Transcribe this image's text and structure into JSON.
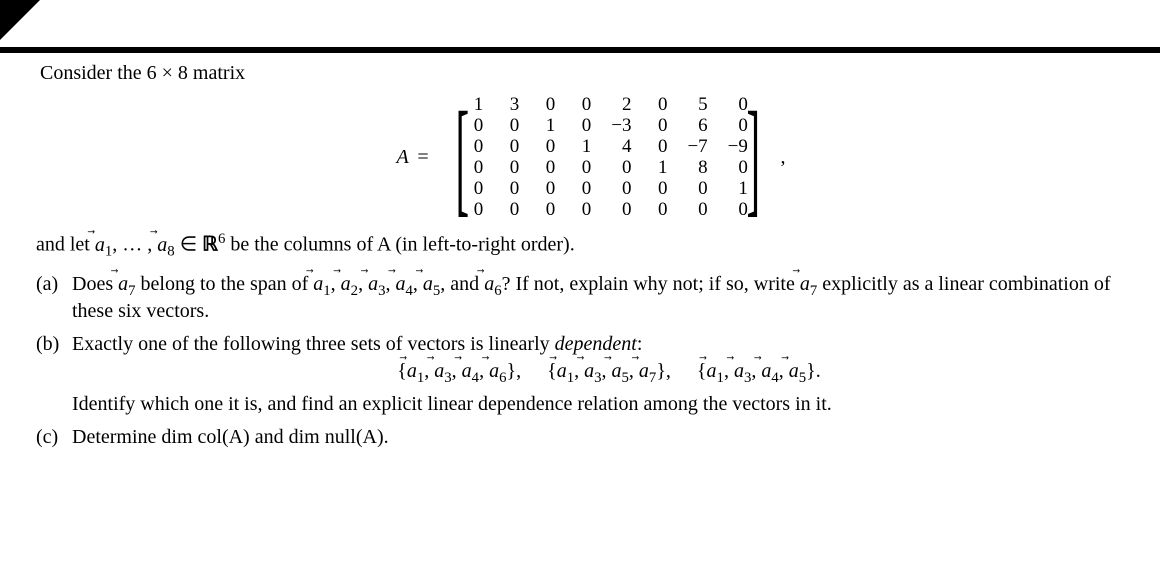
{
  "intro_text": "Consider the 6 × 8 matrix",
  "A_label": "A",
  "equals": "=",
  "matrix_comma": ",",
  "chart_data": {
    "type": "table",
    "title": "Matrix A (6×8)",
    "values": [
      [
        1,
        3,
        0,
        0,
        2,
        0,
        5,
        0
      ],
      [
        0,
        0,
        1,
        0,
        -3,
        0,
        6,
        0
      ],
      [
        0,
        0,
        0,
        1,
        4,
        0,
        -7,
        -9
      ],
      [
        0,
        0,
        0,
        0,
        0,
        1,
        8,
        0
      ],
      [
        0,
        0,
        0,
        0,
        0,
        0,
        0,
        1
      ],
      [
        0,
        0,
        0,
        0,
        0,
        0,
        0,
        0
      ]
    ]
  },
  "cols_text_pre": "and let ",
  "cols_text_vec1": "a⃗",
  "cols_sub1": "1",
  "cols_text_mid": ", … , ",
  "cols_sub8": "8",
  "cols_elem": " ∈ ",
  "cols_R": "ℝ",
  "cols_sup6": "6",
  "cols_text_post": " be the columns of A (in left-to-right order).",
  "qa_label": "(a)",
  "qa_pre": "Does ",
  "qa_sub7": "7",
  "qa_mid1": " belong to the span of ",
  "qa_list_subs": [
    "1",
    "2",
    "3",
    "4",
    "5",
    "6"
  ],
  "qa_and": ", and ",
  "qa_post": "? If not, explain why not; if so, write ",
  "qa_post2": " explicitly as a linear combination of these six vectors.",
  "qb_label": "(b)",
  "qb_pre": "Exactly one of the following three sets of vectors is linearly ",
  "qb_dep": "dependent",
  "qb_colon": ":",
  "sets": [
    {
      "subs": [
        "1",
        "3",
        "4",
        "6"
      ]
    },
    {
      "subs": [
        "1",
        "3",
        "5",
        "7"
      ]
    },
    {
      "subs": [
        "1",
        "3",
        "4",
        "5"
      ]
    }
  ],
  "brace_l": "{",
  "brace_r": "}",
  "set_comma": ", ",
  "set_sep_comma": ",",
  "set_period": ".",
  "qb_post": "Identify which one it is, and find an explicit linear dependence relation among the vectors in it.",
  "qc_label": "(c)",
  "qc_text_pre": "Determine ",
  "qc_dim1": "dim col(A)",
  "qc_and": " and ",
  "qc_dim2": "dim null(A)",
  "qc_period": "."
}
